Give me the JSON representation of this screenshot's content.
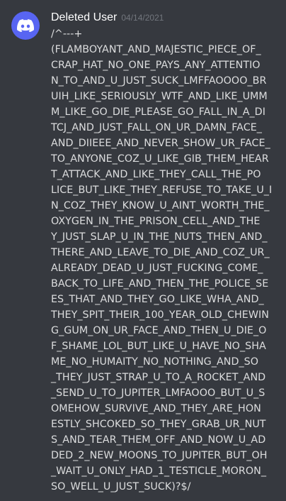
{
  "message": {
    "avatar_icon": "discord-logo-icon",
    "avatar_color": "#5865f2",
    "username": "Deleted User",
    "timestamp": "04/14/2021",
    "lines": [
      "/^---+",
      "(FLAMBOYANT_AND_MAJESTIC_PIECE_OF_",
      "CRAP_HAT_NO_ONE_PAYS_ANY_ATTENTIO",
      "N_TO_AND_U_JUST_SUCK_LMFFAOOOO_BR",
      "UIH_LIKE_SERIOUSLY_WTF_AND_LIKE_UMM",
      "M_LIKE_GO_DIE_PLEASE_GO_FALL_IN_A_DI",
      "TCJ_AND_JUST_FALL_ON_UR_DAMN_FACE_",
      "AND_DIIEEE_AND_NEVER_SHOW_UR_FACE_",
      "TO_ANYONE_COZ_U_LIKE_GIB_THEM_HEAR",
      "T_ATTACK_AND_LIKE_THEY_CALL_THE_PO",
      "LICE_BUT_LIKE_THEY_REFUSE_TO_TAKE_U_I",
      "N_COZ_THEY_KNOW_U_AINT_WORTH_THE_",
      "OXYGEN_IN_THE_PRISON_CELL_AND_THE",
      "Y_JUST_SLAP_U_IN_THE_NUTS_THEN_AND_",
      "THERE_AND_LEAVE_TO_DIE_AND_COZ_UR_",
      "ALREADY_DEAD_U_JUST_FUCKING_COME_",
      "BACK_TO_LIFE_AND_THEN_THE_POLICE_SE",
      "ES_THAT_AND_THEY_GO_LIKE_WHA_AND_",
      "THEY_SPIT_THEIR_100_YEAR_OLD_CHEWIN",
      "G_GUM_ON_UR_FACE_AND_THEN_U_DIE_O",
      "F_SHAME_LOL_BUT_LIKE_U_HAVE_NO_SHA",
      "ME_NO_HUMAITY_NO_NOTHING_AND_SO",
      "_THEY_JUST_STRAP_U_TO_A_ROCKET_AND",
      "_SEND_U_TO_JUPITER_LMFAOOO_BUT_U_S",
      "OMEHOW_SURVIVE_AND_THEY_ARE_HON",
      "ESTLY_SHCOKED_SO_THEY_GRAB_UR_NUT",
      "S_AND_TEAR_THEM_OFF_AND_NOW_U_AD",
      "DED_2_NEW_MOONS_TO_JUPITER_BUT_OH",
      "_WAIT_U_ONLY_HAD_1_TESTICLE_MORON_",
      "SO_WELL_U_JUST_SUCK)?$/"
    ]
  }
}
